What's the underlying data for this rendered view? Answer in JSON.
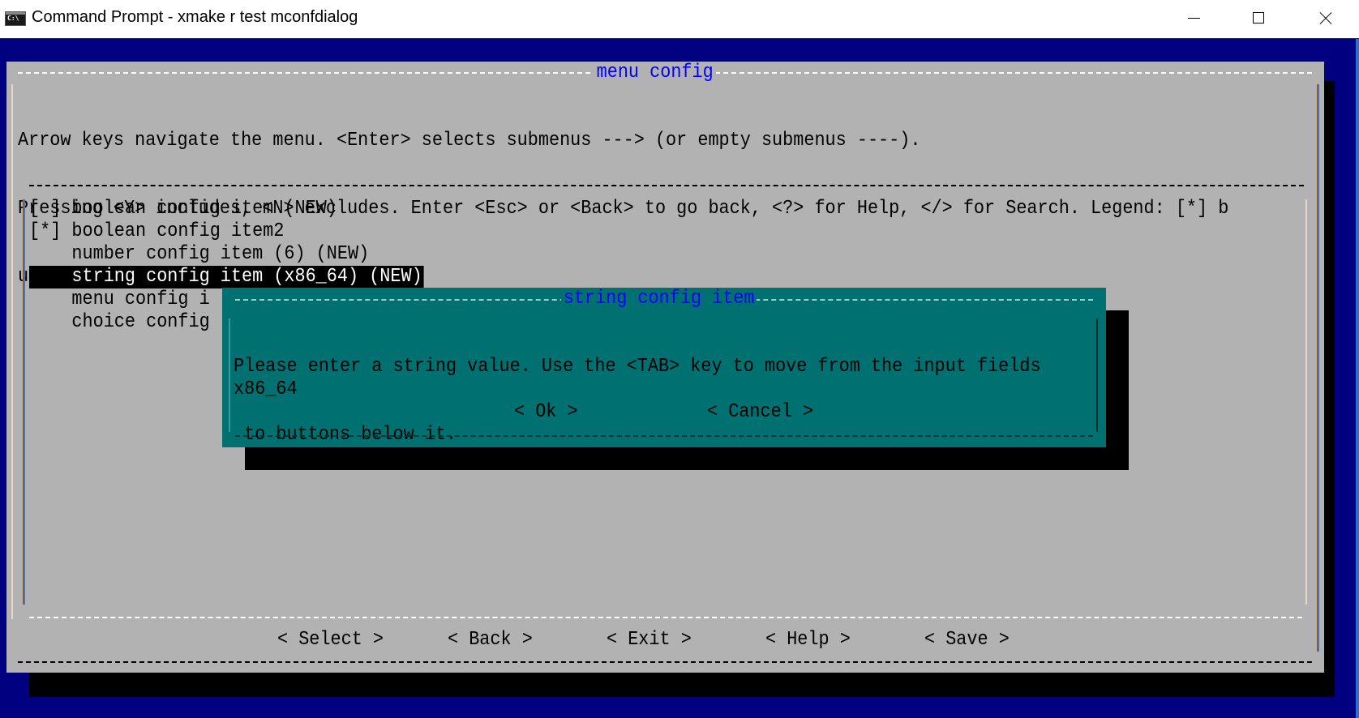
{
  "window": {
    "title": "Command Prompt - xmake  r test mconfdialog",
    "controls": {
      "minimize": "minimize-icon",
      "maximize": "maximize-icon",
      "close": "close-icon"
    }
  },
  "menuconfig": {
    "title": "menu config",
    "help_lines": [
      "Arrow keys navigate the menu. <Enter> selects submenus ---> (or empty submenus ----).",
      "Pressing <Y> includes, <N> excludes. Enter <Esc> or <Back> to go back, <?> for Help, </> for Search. Legend: [*] b",
      "uilt-in  [ ] excluded"
    ],
    "items": [
      {
        "label": "[ ] boolean config item (NEW)",
        "selected": false
      },
      {
        "label": "[*] boolean config item2",
        "selected": false
      },
      {
        "label": "    number config item (6) (NEW)",
        "selected": false
      },
      {
        "label": "    string config item (x86_64) (NEW)",
        "selected": true
      },
      {
        "label": "    menu config i",
        "selected": false
      },
      {
        "label": "    choice config",
        "selected": false
      }
    ],
    "buttons": {
      "select": "< Select >",
      "back": "< Back >",
      "exit": "< Exit >",
      "help": "< Help >",
      "save": "< Save >"
    }
  },
  "dialog": {
    "title": "string config item",
    "message_lines": [
      "Please enter a string value. Use the <TAB> key to move from the input fields",
      " to buttons below it."
    ],
    "input_value": "x86_64",
    "ok_label": "< Ok >",
    "cancel_label": "< Cancel >"
  },
  "colors": {
    "background": "#000080",
    "panel": "#b2b2b2",
    "dialog": "#007070",
    "title_text": "#0000ff",
    "selected_bg": "#000000",
    "selected_fg": "#ffffff"
  }
}
